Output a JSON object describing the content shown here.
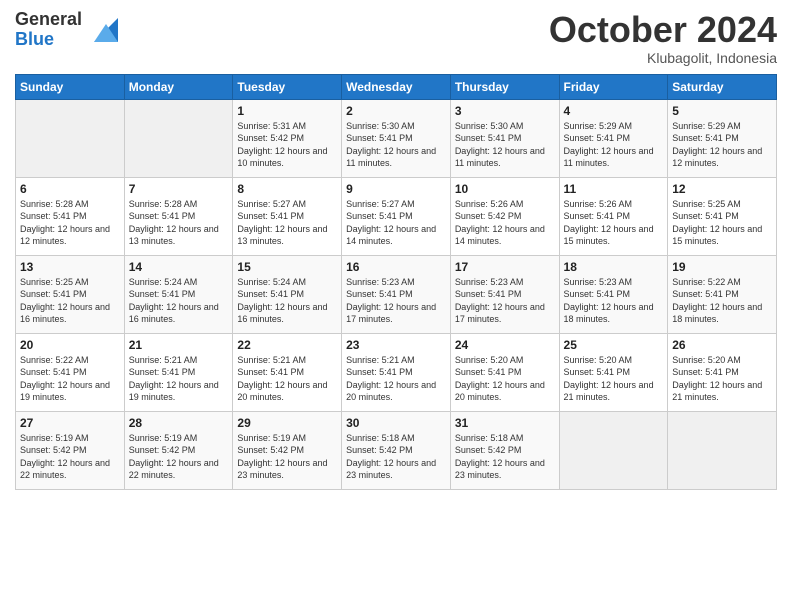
{
  "logo": {
    "general": "General",
    "blue": "Blue"
  },
  "header": {
    "month": "October 2024",
    "location": "Klubagolit, Indonesia"
  },
  "weekdays": [
    "Sunday",
    "Monday",
    "Tuesday",
    "Wednesday",
    "Thursday",
    "Friday",
    "Saturday"
  ],
  "weeks": [
    [
      {
        "day": "",
        "sunrise": "",
        "sunset": "",
        "daylight": ""
      },
      {
        "day": "",
        "sunrise": "",
        "sunset": "",
        "daylight": ""
      },
      {
        "day": "1",
        "sunrise": "Sunrise: 5:31 AM",
        "sunset": "Sunset: 5:42 PM",
        "daylight": "Daylight: 12 hours and 10 minutes."
      },
      {
        "day": "2",
        "sunrise": "Sunrise: 5:30 AM",
        "sunset": "Sunset: 5:41 PM",
        "daylight": "Daylight: 12 hours and 11 minutes."
      },
      {
        "day": "3",
        "sunrise": "Sunrise: 5:30 AM",
        "sunset": "Sunset: 5:41 PM",
        "daylight": "Daylight: 12 hours and 11 minutes."
      },
      {
        "day": "4",
        "sunrise": "Sunrise: 5:29 AM",
        "sunset": "Sunset: 5:41 PM",
        "daylight": "Daylight: 12 hours and 11 minutes."
      },
      {
        "day": "5",
        "sunrise": "Sunrise: 5:29 AM",
        "sunset": "Sunset: 5:41 PM",
        "daylight": "Daylight: 12 hours and 12 minutes."
      }
    ],
    [
      {
        "day": "6",
        "sunrise": "Sunrise: 5:28 AM",
        "sunset": "Sunset: 5:41 PM",
        "daylight": "Daylight: 12 hours and 12 minutes."
      },
      {
        "day": "7",
        "sunrise": "Sunrise: 5:28 AM",
        "sunset": "Sunset: 5:41 PM",
        "daylight": "Daylight: 12 hours and 13 minutes."
      },
      {
        "day": "8",
        "sunrise": "Sunrise: 5:27 AM",
        "sunset": "Sunset: 5:41 PM",
        "daylight": "Daylight: 12 hours and 13 minutes."
      },
      {
        "day": "9",
        "sunrise": "Sunrise: 5:27 AM",
        "sunset": "Sunset: 5:41 PM",
        "daylight": "Daylight: 12 hours and 14 minutes."
      },
      {
        "day": "10",
        "sunrise": "Sunrise: 5:26 AM",
        "sunset": "Sunset: 5:42 PM",
        "daylight": "Daylight: 12 hours and 14 minutes."
      },
      {
        "day": "11",
        "sunrise": "Sunrise: 5:26 AM",
        "sunset": "Sunset: 5:41 PM",
        "daylight": "Daylight: 12 hours and 15 minutes."
      },
      {
        "day": "12",
        "sunrise": "Sunrise: 5:25 AM",
        "sunset": "Sunset: 5:41 PM",
        "daylight": "Daylight: 12 hours and 15 minutes."
      }
    ],
    [
      {
        "day": "13",
        "sunrise": "Sunrise: 5:25 AM",
        "sunset": "Sunset: 5:41 PM",
        "daylight": "Daylight: 12 hours and 16 minutes."
      },
      {
        "day": "14",
        "sunrise": "Sunrise: 5:24 AM",
        "sunset": "Sunset: 5:41 PM",
        "daylight": "Daylight: 12 hours and 16 minutes."
      },
      {
        "day": "15",
        "sunrise": "Sunrise: 5:24 AM",
        "sunset": "Sunset: 5:41 PM",
        "daylight": "Daylight: 12 hours and 16 minutes."
      },
      {
        "day": "16",
        "sunrise": "Sunrise: 5:23 AM",
        "sunset": "Sunset: 5:41 PM",
        "daylight": "Daylight: 12 hours and 17 minutes."
      },
      {
        "day": "17",
        "sunrise": "Sunrise: 5:23 AM",
        "sunset": "Sunset: 5:41 PM",
        "daylight": "Daylight: 12 hours and 17 minutes."
      },
      {
        "day": "18",
        "sunrise": "Sunrise: 5:23 AM",
        "sunset": "Sunset: 5:41 PM",
        "daylight": "Daylight: 12 hours and 18 minutes."
      },
      {
        "day": "19",
        "sunrise": "Sunrise: 5:22 AM",
        "sunset": "Sunset: 5:41 PM",
        "daylight": "Daylight: 12 hours and 18 minutes."
      }
    ],
    [
      {
        "day": "20",
        "sunrise": "Sunrise: 5:22 AM",
        "sunset": "Sunset: 5:41 PM",
        "daylight": "Daylight: 12 hours and 19 minutes."
      },
      {
        "day": "21",
        "sunrise": "Sunrise: 5:21 AM",
        "sunset": "Sunset: 5:41 PM",
        "daylight": "Daylight: 12 hours and 19 minutes."
      },
      {
        "day": "22",
        "sunrise": "Sunrise: 5:21 AM",
        "sunset": "Sunset: 5:41 PM",
        "daylight": "Daylight: 12 hours and 20 minutes."
      },
      {
        "day": "23",
        "sunrise": "Sunrise: 5:21 AM",
        "sunset": "Sunset: 5:41 PM",
        "daylight": "Daylight: 12 hours and 20 minutes."
      },
      {
        "day": "24",
        "sunrise": "Sunrise: 5:20 AM",
        "sunset": "Sunset: 5:41 PM",
        "daylight": "Daylight: 12 hours and 20 minutes."
      },
      {
        "day": "25",
        "sunrise": "Sunrise: 5:20 AM",
        "sunset": "Sunset: 5:41 PM",
        "daylight": "Daylight: 12 hours and 21 minutes."
      },
      {
        "day": "26",
        "sunrise": "Sunrise: 5:20 AM",
        "sunset": "Sunset: 5:41 PM",
        "daylight": "Daylight: 12 hours and 21 minutes."
      }
    ],
    [
      {
        "day": "27",
        "sunrise": "Sunrise: 5:19 AM",
        "sunset": "Sunset: 5:42 PM",
        "daylight": "Daylight: 12 hours and 22 minutes."
      },
      {
        "day": "28",
        "sunrise": "Sunrise: 5:19 AM",
        "sunset": "Sunset: 5:42 PM",
        "daylight": "Daylight: 12 hours and 22 minutes."
      },
      {
        "day": "29",
        "sunrise": "Sunrise: 5:19 AM",
        "sunset": "Sunset: 5:42 PM",
        "daylight": "Daylight: 12 hours and 23 minutes."
      },
      {
        "day": "30",
        "sunrise": "Sunrise: 5:18 AM",
        "sunset": "Sunset: 5:42 PM",
        "daylight": "Daylight: 12 hours and 23 minutes."
      },
      {
        "day": "31",
        "sunrise": "Sunrise: 5:18 AM",
        "sunset": "Sunset: 5:42 PM",
        "daylight": "Daylight: 12 hours and 23 minutes."
      },
      {
        "day": "",
        "sunrise": "",
        "sunset": "",
        "daylight": ""
      },
      {
        "day": "",
        "sunrise": "",
        "sunset": "",
        "daylight": ""
      }
    ]
  ]
}
